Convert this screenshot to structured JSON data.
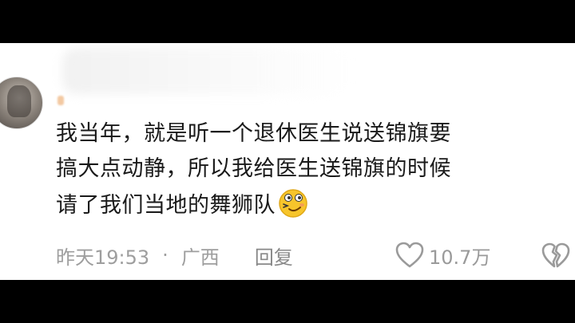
{
  "comment": {
    "lines": [
      "我当年，就是听一个退休医生说送锦旗要",
      "搞大点动静，所以我给医生送锦旗的时候",
      "请了我们当地的舞狮队"
    ],
    "emoji": "smirk-face-emoji"
  },
  "meta": {
    "time": "昨天19:53",
    "separator": "·",
    "location": "广西",
    "reply_label": "回复"
  },
  "like": {
    "icon": "heart-outline-icon",
    "count": "10.7万"
  },
  "dislike": {
    "icon": "broken-heart-icon"
  },
  "colors": {
    "text": "#1a1a1a",
    "meta": "#9e9e9e",
    "background": "#ffffff",
    "letterbox": "#000000"
  }
}
